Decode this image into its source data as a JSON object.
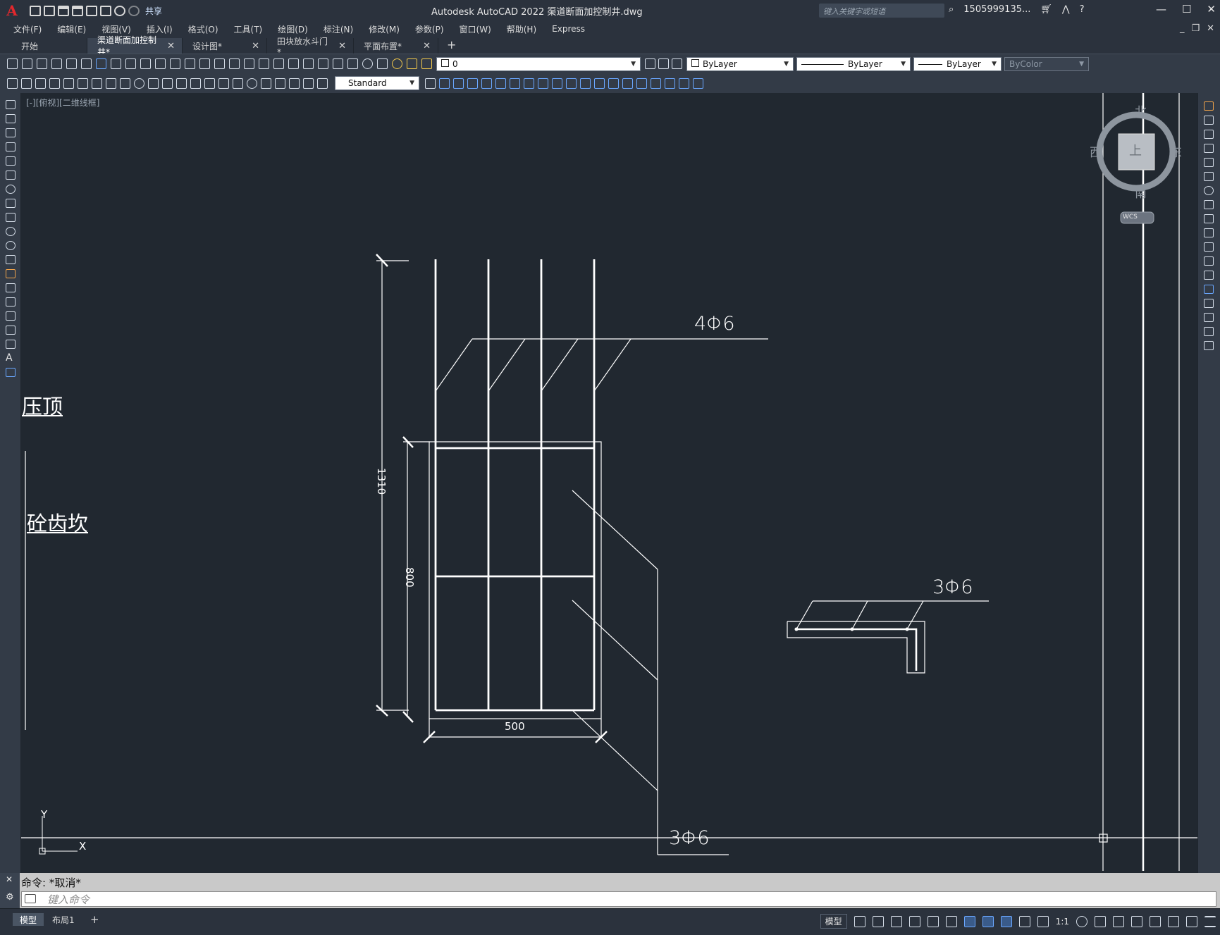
{
  "app": {
    "title": "Autodesk AutoCAD 2022    渠道断面加控制井.dwg",
    "logo": "A",
    "share_label": "共享",
    "search_placeholder": "键入关键字或短语",
    "user": "1505999135...",
    "help": "?"
  },
  "menu": [
    "文件(F)",
    "编辑(E)",
    "视图(V)",
    "插入(I)",
    "格式(O)",
    "工具(T)",
    "绘图(D)",
    "标注(N)",
    "修改(M)",
    "参数(P)",
    "窗口(W)",
    "帮助(H)",
    "Express"
  ],
  "tabs": [
    {
      "label": "开始",
      "active": false,
      "closable": false
    },
    {
      "label": "渠道断面加控制井*",
      "active": true,
      "closable": true
    },
    {
      "label": "设计图*",
      "active": false,
      "closable": true
    },
    {
      "label": "田块放水斗门*",
      "active": false,
      "closable": true
    },
    {
      "label": "平面布置*",
      "active": false,
      "closable": true
    }
  ],
  "properties": {
    "layer": "0",
    "color": "ByLayer",
    "linetype": "ByLayer",
    "lineweight": "ByLayer",
    "plotstyle": "ByColor",
    "textstyle": "Standard"
  },
  "viewport": {
    "label": "[-][俯视][二维线框]",
    "viewcube": {
      "north": "北",
      "south": "南",
      "east": "东",
      "west": "西",
      "top": "上",
      "wcs": "WCS"
    },
    "ucs": {
      "x": "X",
      "y": "Y"
    }
  },
  "drawing": {
    "left_texts": [
      "压顶",
      "砼齿坎"
    ],
    "dims": {
      "height_total": "1310",
      "height_cage": "800",
      "width": "500"
    },
    "rebar_labels": [
      "4Φ6",
      "3Φ6",
      "3Φ6"
    ]
  },
  "command": {
    "history": "命令: *取消*",
    "placeholder": "键入命令"
  },
  "status": {
    "layout_tabs": [
      "模型",
      "布局1"
    ],
    "model_button": "模型",
    "scale": "1:1"
  },
  "colors": {
    "background": "#212830",
    "ui_dark": "#2b323d",
    "accent": "#6aa7ff"
  }
}
